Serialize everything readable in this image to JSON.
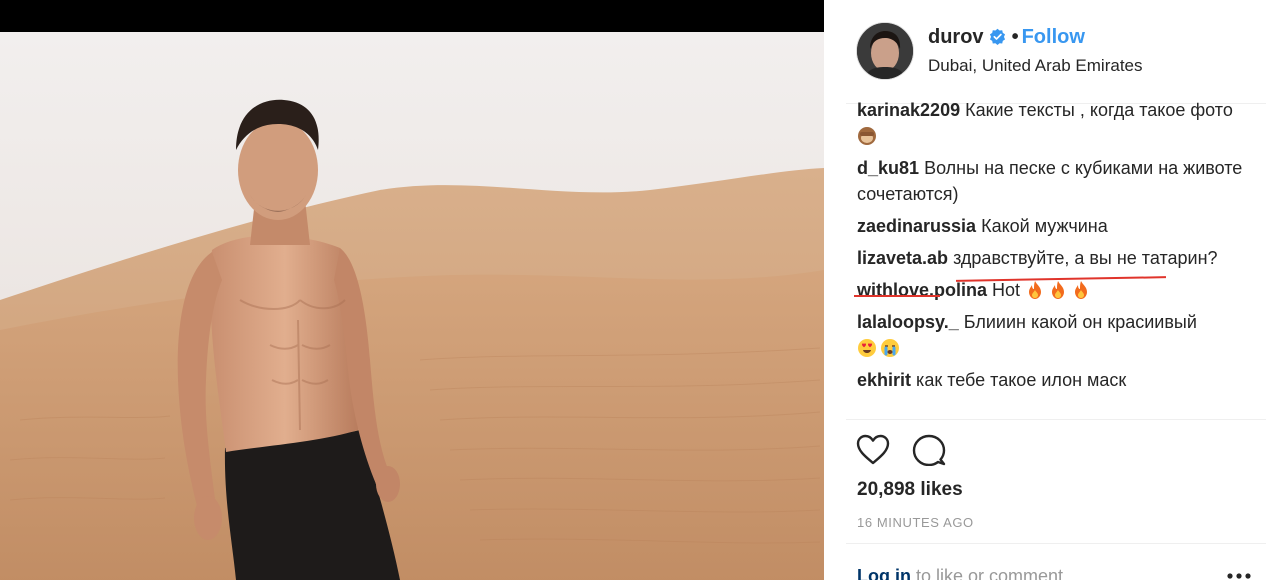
{
  "post": {
    "username": "durov",
    "follow_label": "Follow",
    "separator": "•",
    "location": "Dubai, United Arab Emirates",
    "icons": {
      "verified": "verified-badge-icon",
      "like": "heart-icon",
      "comment": "comment-bubble-icon",
      "more": "more-options-icon"
    },
    "colors": {
      "accent": "#3897f0",
      "highlight": "#e0342b",
      "muted": "#999999"
    }
  },
  "comments": [
    {
      "author": "karinak2209",
      "text": "Какие тексты , когда такое фото",
      "emoji": [
        "see-no-evil-monkey"
      ]
    },
    {
      "author": "d_ku81",
      "text": "Волны на песке с кубиками на животе сочетаются)",
      "emoji": []
    },
    {
      "author": "zaedinarussia",
      "text": "Какой мужчина",
      "emoji": []
    },
    {
      "author": "lizaveta.ab",
      "text": "здравствуйте, а вы не татарин?",
      "emoji": []
    },
    {
      "author": "withlove.polina",
      "text": "Hot",
      "emoji": [
        "fire",
        "fire",
        "fire"
      ]
    },
    {
      "author": "lalaloopsy._",
      "text": "Блииин какой он красиивый",
      "emoji": [
        "heart-eyes",
        "crying-face"
      ]
    },
    {
      "author": "ekhirit",
      "text": "как тебе такое илон маск",
      "emoji": []
    }
  ],
  "engagement": {
    "likes": "20,898 likes",
    "timestamp": "16 MINUTES AGO"
  },
  "footer": {
    "login_link": "Log in",
    "login_rest": " to like or comment."
  }
}
